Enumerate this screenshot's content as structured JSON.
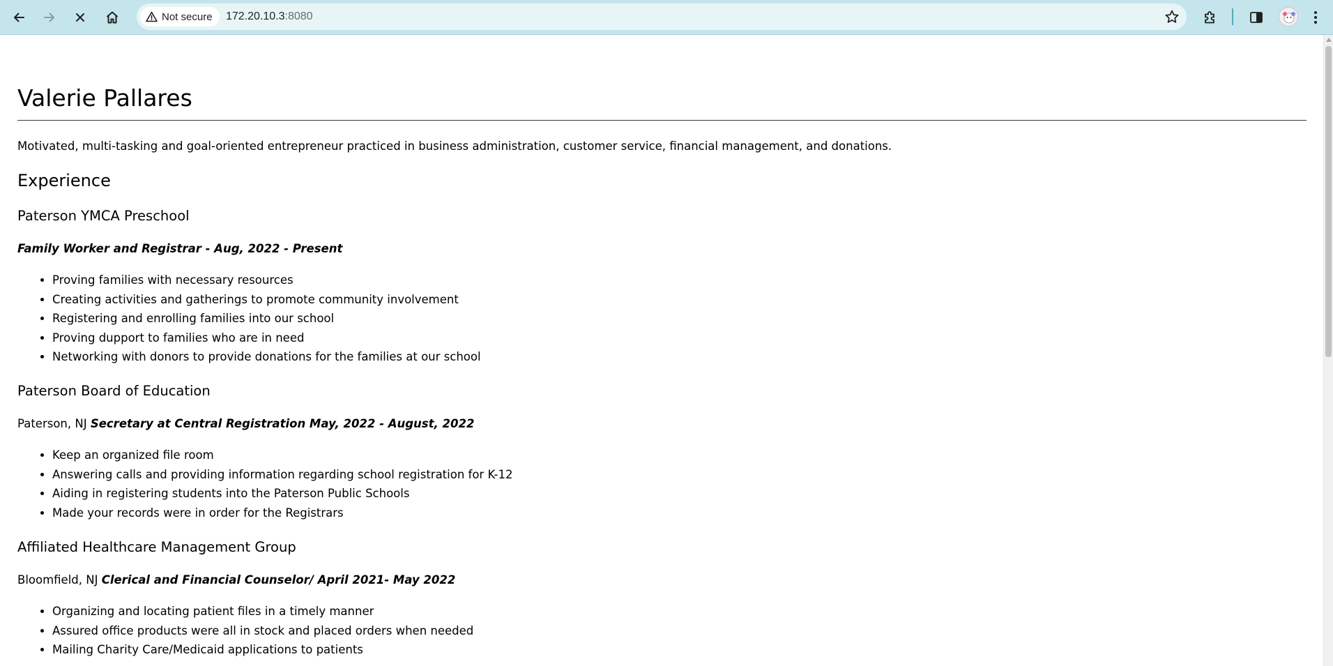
{
  "browser": {
    "security_label": "Not secure",
    "url_host": "172.20.10.3",
    "url_port": ":8080",
    "page_loading": true,
    "scroll_position_fraction": 0.0,
    "visible_fraction": 0.49
  },
  "resume": {
    "name": "Valerie Pallares",
    "summary": "Motivated, multi-tasking and goal-oriented entrepreneur practiced in business administration, customer service, financial management, and donations.",
    "experience_heading": "Experience",
    "jobs": [
      {
        "organization": "Paterson YMCA Preschool",
        "location": "",
        "title": "Family Worker and Registrar - Aug, 2022 - Present",
        "duties": [
          "Proving families with necessary resources",
          "Creating activities and gatherings to promote community involvement",
          "Registering and enrolling families into our school",
          "Proving dupport to families who are in need",
          "Networking with donors to provide donations for the families at our school"
        ]
      },
      {
        "organization": "Paterson Board of Education",
        "location": "Paterson, NJ",
        "title": "Secretary at Central Registration May, 2022 - August, 2022",
        "duties": [
          "Keep an organized file room",
          "Answering calls and providing information regarding school registration for K-12",
          "Aiding in registering students into the Paterson Public Schools",
          "Made your records were in order for the Registrars"
        ]
      },
      {
        "organization": "Affiliated Healthcare Management Group",
        "location": "Bloomfield, NJ",
        "title": "Clerical and Financial Counselor/ April 2021- May 2022",
        "duties": [
          "Organizing and locating patient files in a timely manner",
          "Assured office products were all in stock and placed orders when needed",
          "Mailing Charity Care/Medicaid applications to patients"
        ]
      }
    ]
  }
}
